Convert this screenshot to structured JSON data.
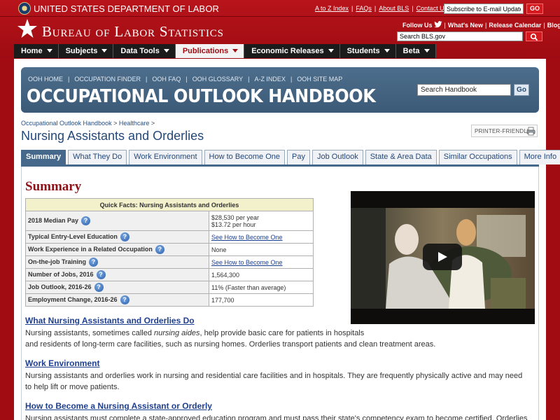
{
  "header": {
    "dol_name": "UNITED STATES DEPARTMENT OF LABOR",
    "bls_name": "Bureau of Labor Statistics",
    "top_links": [
      "A to Z Index",
      "FAQs",
      "About BLS",
      "Contact Us"
    ],
    "email_placeholder": "Subscribe to E-mail Updates",
    "go_label": "GO",
    "follow_us": "Follow Us",
    "right_links": [
      "What's New",
      "Release Calendar",
      "Blog"
    ],
    "search_placeholder": "Search BLS.gov"
  },
  "nav": {
    "items": [
      "Home",
      "Subjects",
      "Data Tools",
      "Publications",
      "Economic Releases",
      "Students",
      "Beta"
    ],
    "active": "Publications"
  },
  "ooh": {
    "links": [
      "OOH HOME",
      "OCCUPATION FINDER",
      "OOH FAQ",
      "OOH GLOSSARY",
      "A-Z INDEX",
      "OOH SITE MAP"
    ],
    "title": "OCCUPATIONAL OUTLOOK HANDBOOK",
    "search_value": "Search Handbook",
    "go_label": "Go"
  },
  "breadcrumb": [
    "Occupational Outlook Handbook",
    "Healthcare"
  ],
  "page_title": "Nursing Assistants and Orderlies",
  "printer_label": "PRINTER-FRIENDLY",
  "tabs": [
    "Summary",
    "What They Do",
    "Work Environment",
    "How to Become One",
    "Pay",
    "Job Outlook",
    "State & Area Data",
    "Similar Occupations",
    "More Info"
  ],
  "summary_heading": "Summary",
  "quick_facts": {
    "title": "Quick Facts: Nursing Assistants and Orderlies",
    "rows": [
      {
        "label": "2018 Median Pay",
        "value": "$28,530 per year",
        "value2": "$13.72 per hour"
      },
      {
        "label": "Typical Entry-Level Education",
        "value": "See How to Become One"
      },
      {
        "label": "Work Experience in a Related Occupation",
        "value": "None"
      },
      {
        "label": "On-the-job Training",
        "value": "See How to Become One"
      },
      {
        "label": "Number of Jobs, 2016",
        "value": "1,564,300"
      },
      {
        "label": "Job Outlook, 2016-26",
        "value": "11% (Faster than average)"
      },
      {
        "label": "Employment Change, 2016-26",
        "value": "177,700"
      }
    ]
  },
  "sections": [
    {
      "heading": "What Nursing Assistants and Orderlies Do",
      "text_pre": "Nursing assistants, sometimes called ",
      "text_em": "nursing aides",
      "text_post": ", help provide basic care for patients in hospitals",
      "text_line2": "and residents of long-term care facilities, such as nursing homes. Orderlies transport patients and clean treatment areas."
    },
    {
      "heading": "Work Environment",
      "text": "Nursing assistants and orderlies work in nursing and residential care facilities and in hospitals. They are frequently physically active and may need to help lift or move patients."
    },
    {
      "heading": "How to Become a Nursing Assistant or Orderly",
      "text": "Nursing assistants must complete a state-approved education program and must pass their state's competency exam to become certified. Orderlies generally"
    }
  ]
}
